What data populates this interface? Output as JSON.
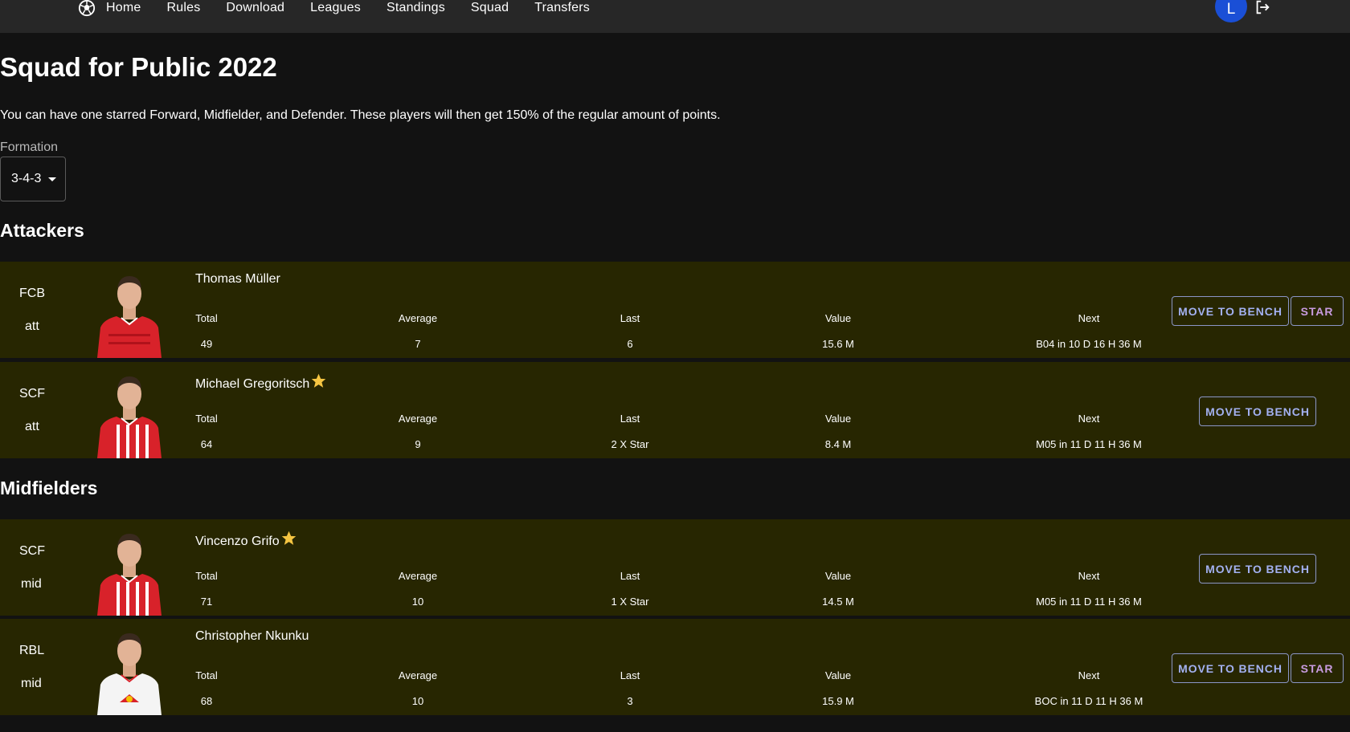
{
  "nav": {
    "items": [
      "Home",
      "Rules",
      "Download",
      "Leagues",
      "Standings",
      "Squad",
      "Transfers"
    ],
    "avatar_letter": "L",
    "logo_icon": "soccer-ball-icon",
    "logout_icon": "logout-icon"
  },
  "page": {
    "title": "Squad for Public 2022",
    "description": "You can have one starred Forward, Midfielder, and Defender. These players will then get 150% of the regular amount of points.",
    "formation_label": "Formation",
    "formation_value": "3-4-3"
  },
  "stat_labels": {
    "total": "Total",
    "average": "Average",
    "last": "Last",
    "value": "Value",
    "next": "Next"
  },
  "buttons": {
    "bench": "MOVE TO BENCH",
    "star": "STAR"
  },
  "sections": [
    {
      "heading": "Attackers",
      "players": [
        {
          "club": "FCB",
          "position": "att",
          "name": "Thomas Müller",
          "starred": false,
          "total": "49",
          "average": "7",
          "last": "6",
          "value": "15.6 M",
          "next": "B04 in 10 D 16 H 36 M",
          "can_star": true,
          "kit": "fcb"
        },
        {
          "club": "SCF",
          "position": "att",
          "name": "Michael Gregoritsch",
          "starred": true,
          "total": "64",
          "average": "9",
          "last": "2 X Star",
          "value": "8.4 M",
          "next": "M05 in 11 D 11 H 36 M",
          "can_star": false,
          "kit": "scf"
        }
      ]
    },
    {
      "heading": "Midfielders",
      "players": [
        {
          "club": "SCF",
          "position": "mid",
          "name": "Vincenzo Grifo",
          "starred": true,
          "total": "71",
          "average": "10",
          "last": "1 X Star",
          "value": "14.5 M",
          "next": "M05 in 11 D 11 H 36 M",
          "can_star": false,
          "kit": "scf"
        },
        {
          "club": "RBL",
          "position": "mid",
          "name": "Christopher Nkunku",
          "starred": false,
          "total": "68",
          "average": "10",
          "last": "3",
          "value": "15.9 M",
          "next": "BOC in 11 D 11 H 36 M",
          "can_star": true,
          "kit": "rbl"
        }
      ]
    }
  ],
  "colors": {
    "row_bg": "#272601",
    "page_bg": "#121212",
    "topbar_bg": "#272727",
    "accent": "#a3b1f2",
    "avatar": "#1a4fd6",
    "star": "#f5c542"
  }
}
